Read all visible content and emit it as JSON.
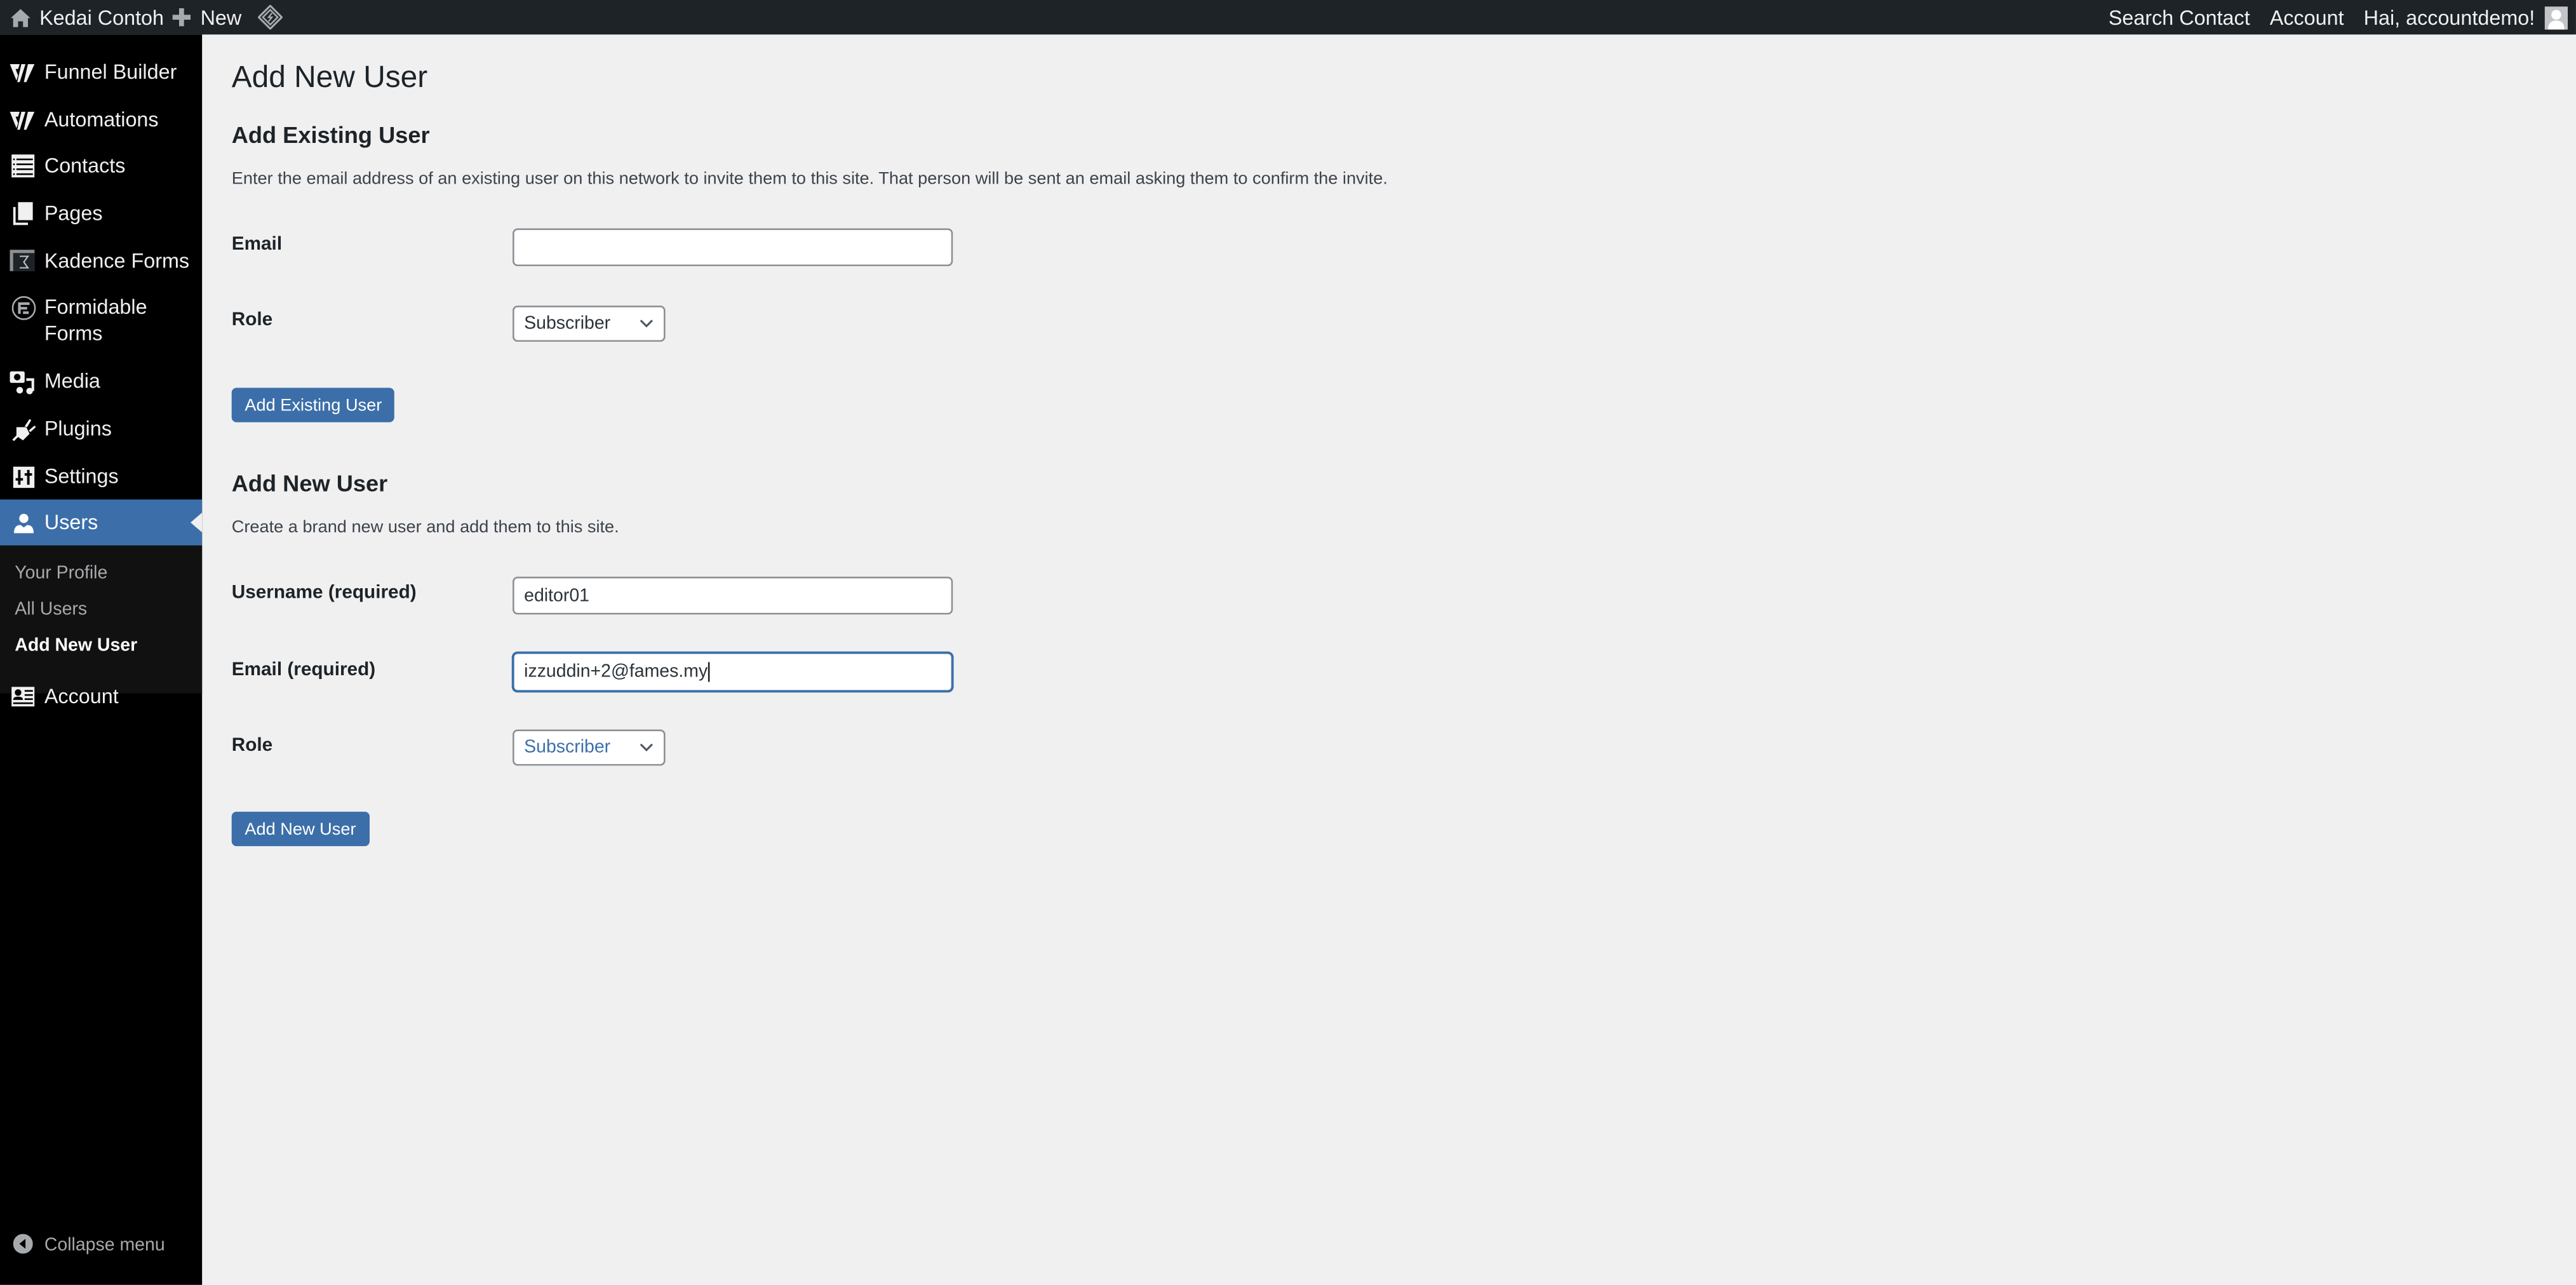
{
  "admin_bar": {
    "site_name": "Kedai Contoh",
    "new_label": "New",
    "right_items": [
      "Search Contact",
      "Account"
    ],
    "greeting": "Hai, accountdemo!",
    "icons": {
      "site": "home-icon",
      "new": "plus-icon",
      "plugin": "diamond-logo-icon",
      "user": "avatar-icon"
    }
  },
  "sidebar": {
    "items": [
      {
        "label": "Funnel Builder",
        "icon": "funnelkit-icon"
      },
      {
        "label": "Automations",
        "icon": "funnelkit-icon"
      },
      {
        "label": "Contacts",
        "icon": "list-icon"
      },
      {
        "label": "Pages",
        "icon": "pages-icon"
      },
      {
        "label": "Kadence Forms",
        "icon": "kadence-forms-icon"
      },
      {
        "label": "Formidable Forms",
        "icon": "formidable-icon"
      },
      {
        "label": "Media",
        "icon": "media-icon"
      },
      {
        "label": "Plugins",
        "icon": "plugin-icon"
      },
      {
        "label": "Settings",
        "icon": "settings-icon"
      },
      {
        "label": "Users",
        "icon": "users-icon",
        "active": true
      },
      {
        "label": "Account",
        "icon": "account-card-icon"
      }
    ],
    "submenu": [
      "Your Profile",
      "All Users",
      "Add New User"
    ],
    "submenu_current": "Add New User",
    "collapse_label": "Collapse menu"
  },
  "page": {
    "title": "Add New User",
    "existing": {
      "heading": "Add Existing User",
      "description": "Enter the email address of an existing user on this network to invite them to this site. That person will be sent an email asking them to confirm the invite.",
      "email_label": "Email",
      "email_value": "",
      "role_label": "Role",
      "role_value": "Subscriber",
      "button": "Add Existing User"
    },
    "new_user": {
      "heading": "Add New User",
      "description": "Create a brand new user and add them to this site.",
      "username_label": "Username (required)",
      "username_value": "editor01",
      "email_label": "Email (required)",
      "email_value": "izzuddin+2@fames.my",
      "role_label": "Role",
      "role_value": "Subscriber",
      "button": "Add New User"
    }
  },
  "colors": {
    "accent": "#3c6fa9",
    "admin_bar": "#1d2327",
    "sidebar": "#000000",
    "background": "#f0f0f1"
  }
}
